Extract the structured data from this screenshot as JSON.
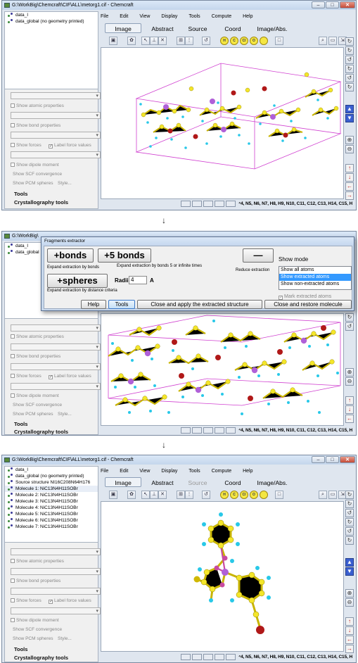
{
  "window1": {
    "title": "G:\\WorkBig\\Chemcraft\\CIF\\ALL\\metorg1.cif - Chemcraft",
    "tree": [
      "data_I",
      "data_global (no geometry printed)"
    ]
  },
  "window2": {
    "title": "G:\\WorkBig\\",
    "tree": [
      "data_I",
      "data_global"
    ]
  },
  "window3": {
    "title": "G:\\WorkBig\\Chemcraft\\CIF\\ALL\\metorg1.cif - Chemcraft",
    "tree": [
      "data_I",
      "data_global (no geometry printed)",
      "Source structure NI16C208N64H176",
      "Molecule 1: NiC13N4H11SOBr",
      "Molecule 2: NiC13N4H11SOBr",
      "Molecule 3: NiC13N4H11SOBr",
      "Molecule 4: NiC13N4H11SOBr",
      "Molecule 5: NiC13N4H11SOBr",
      "Molecule 6: NiC13N4H11SOBr",
      "Molecule 7: NiC13N4H11SOBr"
    ]
  },
  "window_controls": {
    "min": "–",
    "max": "□",
    "close": "✕"
  },
  "props": {
    "atomic": "Show atomic properties",
    "bond": "Show bond properties",
    "forces": "Show forces",
    "label_force": "Label force values",
    "dipole": "Show dipole moment",
    "scf": "Show SCF convergence",
    "pcm": "Show PCM spheres",
    "style": "Style...",
    "tools": "Tools",
    "crystal": "Crystallography tools"
  },
  "menu": [
    "File",
    "Edit",
    "View",
    "Display",
    "Tools",
    "Compute",
    "Help"
  ],
  "tabs": [
    "Image",
    "Abstract",
    "Source",
    "Coord",
    "Image/Abs."
  ],
  "status_text": "⁴4, N5, N6, N7, H8, H9, N10, C11, C12, C13, H14, C15, H",
  "arrow": "↓",
  "dialog": {
    "title": "Fragments extractor",
    "bonds_btn": "+bonds",
    "five_bonds_btn": "+5 bonds",
    "minus_btn": "—",
    "expand_bonds": "Expand extraction by bonds",
    "expand_bonds5": "Expand extraction by bonds 5 or infinite times",
    "reduce": "Reduce extraction",
    "spheres_btn": "+spheres",
    "radii_label": "Radii",
    "radii_value": "4",
    "radii_unit": "A",
    "expand_spheres": "Expand extraction by distance criteria",
    "show_mode_label": "Show mode",
    "modes": [
      "Show all atoms",
      "Show extracted atoms",
      "Show non-extracted atoms"
    ],
    "mark": "Mark extracted atoms",
    "help_btn": "Help",
    "tools_btn": "Tools",
    "apply_btn": "Close and apply the extracted structure",
    "restore_btn": "Close and restore molecule"
  },
  "colors": {
    "carbon": "#f4e62a",
    "hydrogen": "#28c8e8",
    "nickel": "#b060d8",
    "bromine": "#b01818",
    "cell": "#d040d0",
    "bond": "#c8b400"
  }
}
